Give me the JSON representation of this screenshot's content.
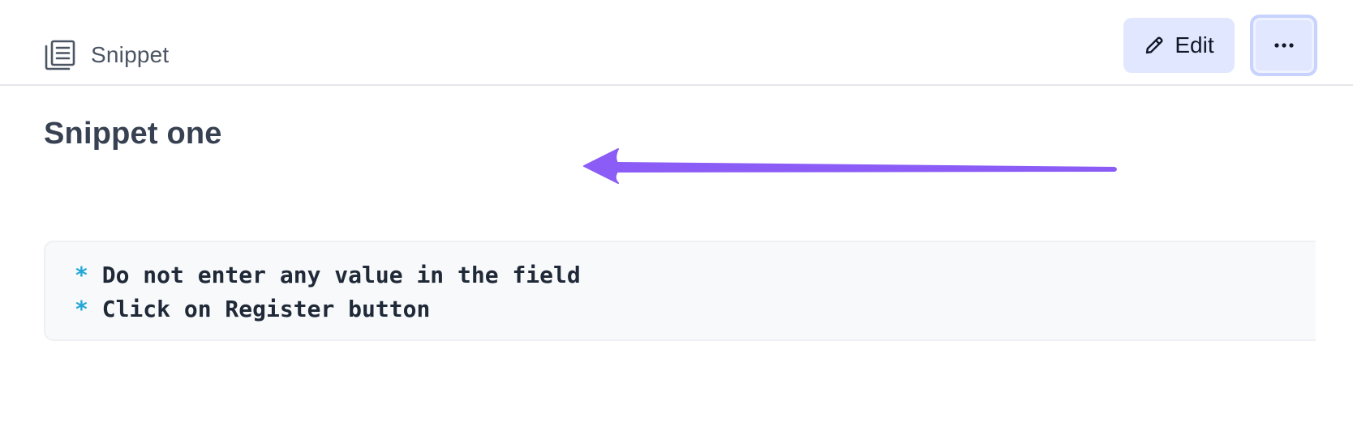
{
  "header": {
    "breadcrumb_label": "Snippet",
    "breadcrumb_icon": "snippet-document-icon",
    "edit_label": "Edit",
    "edit_icon": "pencil-icon",
    "more_icon": "ellipsis-icon"
  },
  "main": {
    "title": "Snippet one",
    "code_lines": [
      {
        "bullet": "*",
        "text": "Do not enter any value in the field"
      },
      {
        "bullet": "*",
        "text": "Click on Register button"
      }
    ]
  },
  "annotation": {
    "arrow_icon": "left-arrow-annotation",
    "arrow_color": "#8b5cf6"
  },
  "colors": {
    "button_bg": "#e0e7ff",
    "bullet": "#22a7d6",
    "code_bg": "#f8f9fb"
  }
}
